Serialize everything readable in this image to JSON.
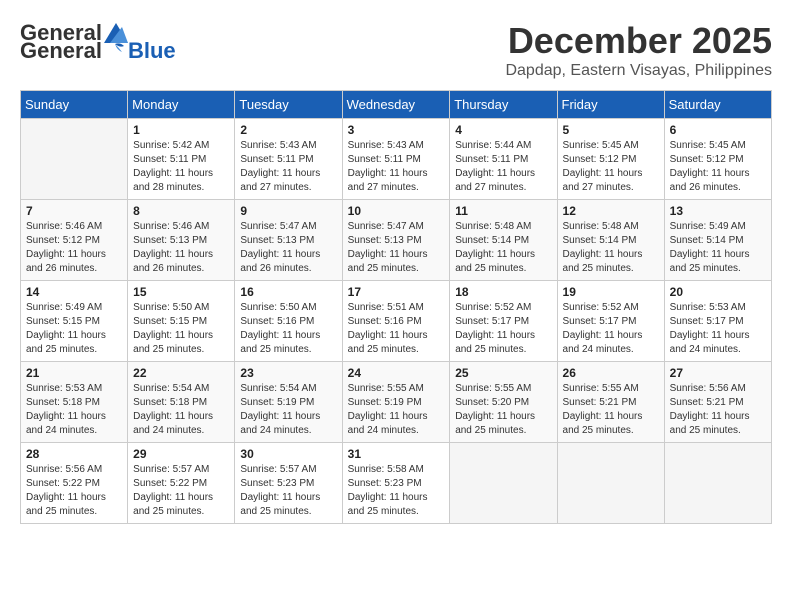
{
  "header": {
    "logo_general": "General",
    "logo_blue": "Blue",
    "month_year": "December 2025",
    "location": "Dapdap, Eastern Visayas, Philippines"
  },
  "weekdays": [
    "Sunday",
    "Monday",
    "Tuesday",
    "Wednesday",
    "Thursday",
    "Friday",
    "Saturday"
  ],
  "weeks": [
    [
      {
        "day": "",
        "sunrise": "",
        "sunset": "",
        "daylight": ""
      },
      {
        "day": "1",
        "sunrise": "Sunrise: 5:42 AM",
        "sunset": "Sunset: 5:11 PM",
        "daylight": "Daylight: 11 hours and 28 minutes."
      },
      {
        "day": "2",
        "sunrise": "Sunrise: 5:43 AM",
        "sunset": "Sunset: 5:11 PM",
        "daylight": "Daylight: 11 hours and 27 minutes."
      },
      {
        "day": "3",
        "sunrise": "Sunrise: 5:43 AM",
        "sunset": "Sunset: 5:11 PM",
        "daylight": "Daylight: 11 hours and 27 minutes."
      },
      {
        "day": "4",
        "sunrise": "Sunrise: 5:44 AM",
        "sunset": "Sunset: 5:11 PM",
        "daylight": "Daylight: 11 hours and 27 minutes."
      },
      {
        "day": "5",
        "sunrise": "Sunrise: 5:45 AM",
        "sunset": "Sunset: 5:12 PM",
        "daylight": "Daylight: 11 hours and 27 minutes."
      },
      {
        "day": "6",
        "sunrise": "Sunrise: 5:45 AM",
        "sunset": "Sunset: 5:12 PM",
        "daylight": "Daylight: 11 hours and 26 minutes."
      }
    ],
    [
      {
        "day": "7",
        "sunrise": "Sunrise: 5:46 AM",
        "sunset": "Sunset: 5:12 PM",
        "daylight": "Daylight: 11 hours and 26 minutes."
      },
      {
        "day": "8",
        "sunrise": "Sunrise: 5:46 AM",
        "sunset": "Sunset: 5:13 PM",
        "daylight": "Daylight: 11 hours and 26 minutes."
      },
      {
        "day": "9",
        "sunrise": "Sunrise: 5:47 AM",
        "sunset": "Sunset: 5:13 PM",
        "daylight": "Daylight: 11 hours and 26 minutes."
      },
      {
        "day": "10",
        "sunrise": "Sunrise: 5:47 AM",
        "sunset": "Sunset: 5:13 PM",
        "daylight": "Daylight: 11 hours and 25 minutes."
      },
      {
        "day": "11",
        "sunrise": "Sunrise: 5:48 AM",
        "sunset": "Sunset: 5:14 PM",
        "daylight": "Daylight: 11 hours and 25 minutes."
      },
      {
        "day": "12",
        "sunrise": "Sunrise: 5:48 AM",
        "sunset": "Sunset: 5:14 PM",
        "daylight": "Daylight: 11 hours and 25 minutes."
      },
      {
        "day": "13",
        "sunrise": "Sunrise: 5:49 AM",
        "sunset": "Sunset: 5:14 PM",
        "daylight": "Daylight: 11 hours and 25 minutes."
      }
    ],
    [
      {
        "day": "14",
        "sunrise": "Sunrise: 5:49 AM",
        "sunset": "Sunset: 5:15 PM",
        "daylight": "Daylight: 11 hours and 25 minutes."
      },
      {
        "day": "15",
        "sunrise": "Sunrise: 5:50 AM",
        "sunset": "Sunset: 5:15 PM",
        "daylight": "Daylight: 11 hours and 25 minutes."
      },
      {
        "day": "16",
        "sunrise": "Sunrise: 5:50 AM",
        "sunset": "Sunset: 5:16 PM",
        "daylight": "Daylight: 11 hours and 25 minutes."
      },
      {
        "day": "17",
        "sunrise": "Sunrise: 5:51 AM",
        "sunset": "Sunset: 5:16 PM",
        "daylight": "Daylight: 11 hours and 25 minutes."
      },
      {
        "day": "18",
        "sunrise": "Sunrise: 5:52 AM",
        "sunset": "Sunset: 5:17 PM",
        "daylight": "Daylight: 11 hours and 25 minutes."
      },
      {
        "day": "19",
        "sunrise": "Sunrise: 5:52 AM",
        "sunset": "Sunset: 5:17 PM",
        "daylight": "Daylight: 11 hours and 24 minutes."
      },
      {
        "day": "20",
        "sunrise": "Sunrise: 5:53 AM",
        "sunset": "Sunset: 5:17 PM",
        "daylight": "Daylight: 11 hours and 24 minutes."
      }
    ],
    [
      {
        "day": "21",
        "sunrise": "Sunrise: 5:53 AM",
        "sunset": "Sunset: 5:18 PM",
        "daylight": "Daylight: 11 hours and 24 minutes."
      },
      {
        "day": "22",
        "sunrise": "Sunrise: 5:54 AM",
        "sunset": "Sunset: 5:18 PM",
        "daylight": "Daylight: 11 hours and 24 minutes."
      },
      {
        "day": "23",
        "sunrise": "Sunrise: 5:54 AM",
        "sunset": "Sunset: 5:19 PM",
        "daylight": "Daylight: 11 hours and 24 minutes."
      },
      {
        "day": "24",
        "sunrise": "Sunrise: 5:55 AM",
        "sunset": "Sunset: 5:19 PM",
        "daylight": "Daylight: 11 hours and 24 minutes."
      },
      {
        "day": "25",
        "sunrise": "Sunrise: 5:55 AM",
        "sunset": "Sunset: 5:20 PM",
        "daylight": "Daylight: 11 hours and 25 minutes."
      },
      {
        "day": "26",
        "sunrise": "Sunrise: 5:55 AM",
        "sunset": "Sunset: 5:21 PM",
        "daylight": "Daylight: 11 hours and 25 minutes."
      },
      {
        "day": "27",
        "sunrise": "Sunrise: 5:56 AM",
        "sunset": "Sunset: 5:21 PM",
        "daylight": "Daylight: 11 hours and 25 minutes."
      }
    ],
    [
      {
        "day": "28",
        "sunrise": "Sunrise: 5:56 AM",
        "sunset": "Sunset: 5:22 PM",
        "daylight": "Daylight: 11 hours and 25 minutes."
      },
      {
        "day": "29",
        "sunrise": "Sunrise: 5:57 AM",
        "sunset": "Sunset: 5:22 PM",
        "daylight": "Daylight: 11 hours and 25 minutes."
      },
      {
        "day": "30",
        "sunrise": "Sunrise: 5:57 AM",
        "sunset": "Sunset: 5:23 PM",
        "daylight": "Daylight: 11 hours and 25 minutes."
      },
      {
        "day": "31",
        "sunrise": "Sunrise: 5:58 AM",
        "sunset": "Sunset: 5:23 PM",
        "daylight": "Daylight: 11 hours and 25 minutes."
      },
      {
        "day": "",
        "sunrise": "",
        "sunset": "",
        "daylight": ""
      },
      {
        "day": "",
        "sunrise": "",
        "sunset": "",
        "daylight": ""
      },
      {
        "day": "",
        "sunrise": "",
        "sunset": "",
        "daylight": ""
      }
    ]
  ]
}
